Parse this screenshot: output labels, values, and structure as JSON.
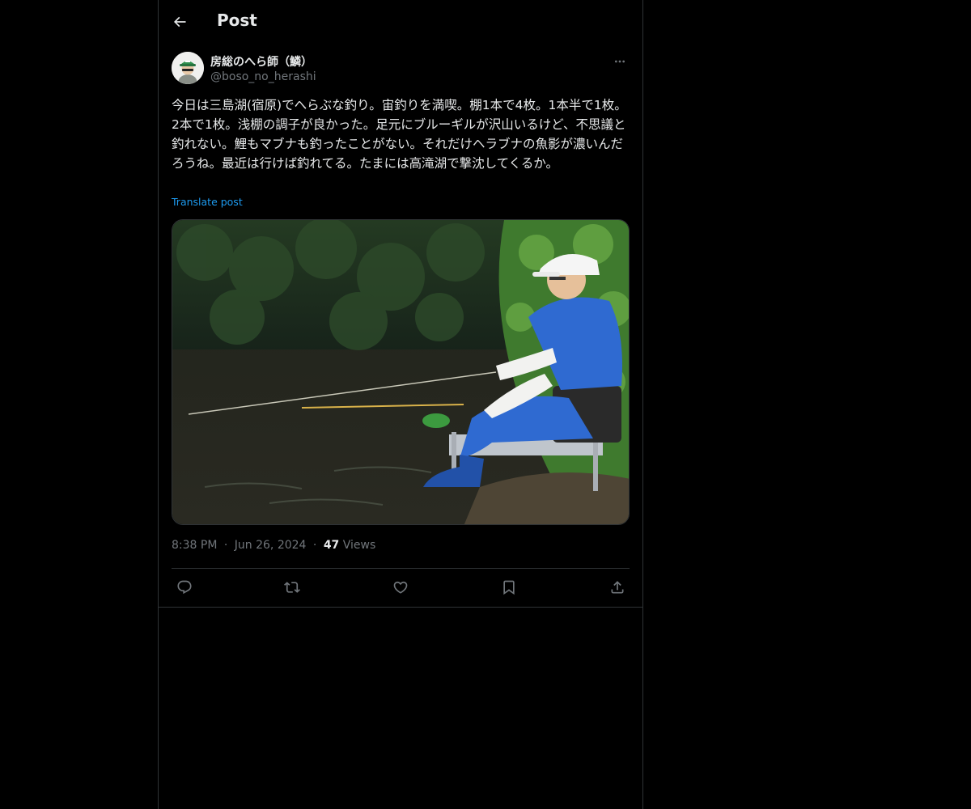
{
  "header": {
    "title": "Post"
  },
  "author": {
    "display_name": "房総のへら師（鱗）",
    "handle": "@boso_no_herashi"
  },
  "post": {
    "text": "今日は三島湖(宿原)でへらぶな釣り。宙釣りを満喫。棚1本で4枚。1本半で1枚。2本で1枚。浅棚の調子が良かった。足元にブルーギルが沢山いるけど、不思議と釣れない。鯉もマブナも釣ったことがない。それだけヘラブナの魚影が濃いんだろうね。最近は行けば釣れてる。たまには高滝湖で撃沈してくるか。",
    "translate_label": "Translate post",
    "time": "8:38 PM",
    "date": "Jun 26, 2024",
    "views_count": "47",
    "views_label": "Views",
    "separator": "·"
  },
  "actions": [
    {
      "icon": "reply-icon"
    },
    {
      "icon": "repost-icon"
    },
    {
      "icon": "like-icon"
    },
    {
      "icon": "bookmark-icon"
    },
    {
      "icon": "share-icon"
    }
  ],
  "colors": {
    "background": "#000000",
    "text": "#e7e9ea",
    "secondary_text": "#71767b",
    "accent": "#1d9bf0",
    "border": "#2f3336"
  }
}
